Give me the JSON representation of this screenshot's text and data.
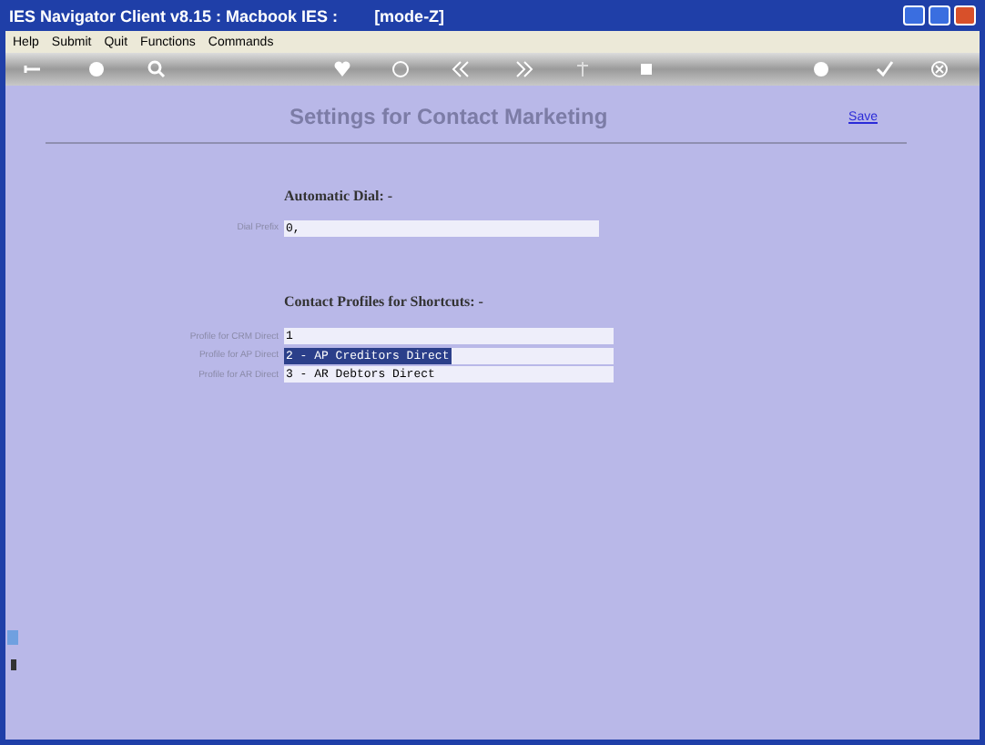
{
  "window": {
    "title": "IES Navigator Client v8.15 : Macbook IES :",
    "mode": "[mode-Z]"
  },
  "menu": [
    "Help",
    "Submit",
    "Quit",
    "Functions",
    "Commands"
  ],
  "page": {
    "title": "Settings for Contact Marketing",
    "save_link": "Save"
  },
  "automatic_dial": {
    "heading": "Automatic Dial: -",
    "fields": [
      {
        "label": "Dial Prefix",
        "value": "0,",
        "selected": false
      }
    ]
  },
  "contact_profiles": {
    "heading": "Contact Profiles for Shortcuts: -",
    "fields": [
      {
        "label": "Profile for CRM Direct",
        "value": "1",
        "selected": false
      },
      {
        "label": "Profile for AP Direct",
        "value": "2 - AP Creditors Direct",
        "selected": true
      },
      {
        "label": "Profile for AR Direct",
        "value": "3 - AR Debtors Direct",
        "selected": false
      }
    ]
  }
}
